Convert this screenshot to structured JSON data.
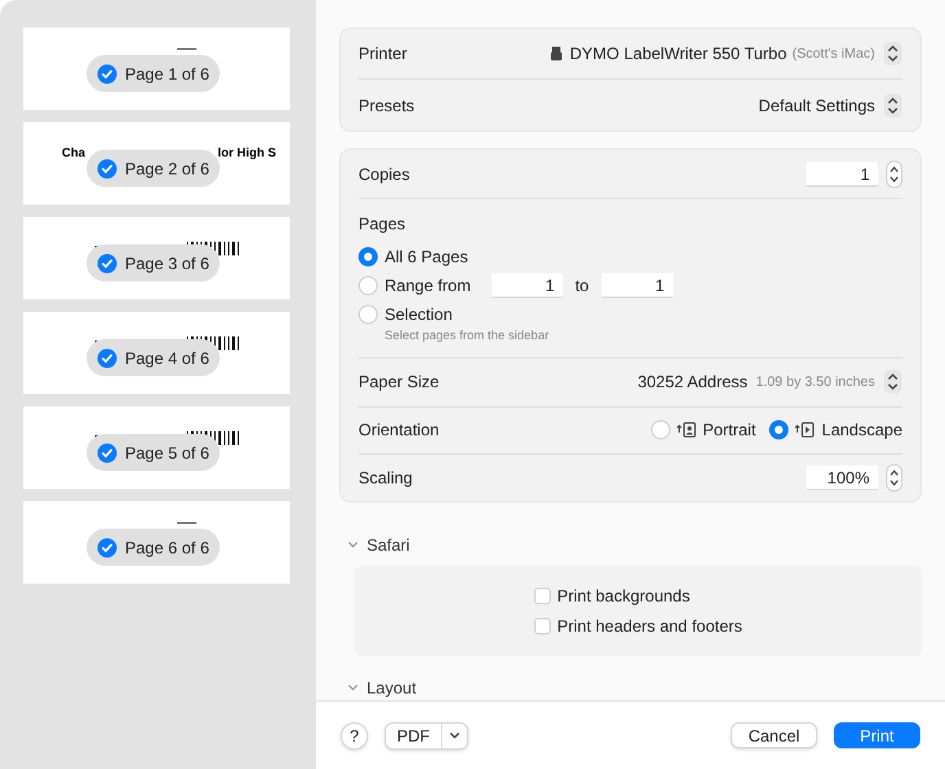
{
  "sidebar": {
    "pages": [
      {
        "label": "Page 1 of 6",
        "selected": true,
        "kind": "mark"
      },
      {
        "label": "Page 2 of 6",
        "selected": true,
        "kind": "text",
        "preview_text": [
          "Cha",
          "lor High S"
        ]
      },
      {
        "label": "Page 3 of 6",
        "selected": true,
        "kind": "barcode"
      },
      {
        "label": "Page 4 of 6",
        "selected": true,
        "kind": "barcode"
      },
      {
        "label": "Page 5 of 6",
        "selected": true,
        "kind": "barcode"
      },
      {
        "label": "Page 6 of 6",
        "selected": true,
        "kind": "mark"
      }
    ]
  },
  "printer": {
    "label": "Printer",
    "value": "DYMO LabelWriter 550 Turbo",
    "host": "(Scott's iMac)"
  },
  "presets": {
    "label": "Presets",
    "value": "Default Settings"
  },
  "copies": {
    "label": "Copies",
    "value": "1"
  },
  "pages": {
    "label": "Pages",
    "options": [
      {
        "label": "All 6 Pages",
        "selected": true,
        "kind": "plain"
      },
      {
        "label": "Range from",
        "selected": false,
        "kind": "range",
        "from": "1",
        "to_label": "to",
        "to": "1"
      },
      {
        "label": "Selection",
        "selected": false,
        "kind": "hint",
        "hint": "Select pages from the sidebar"
      }
    ]
  },
  "paper_size": {
    "label": "Paper Size",
    "value": "30252 Address",
    "detail": "1.09 by 3.50 inches"
  },
  "orientation": {
    "label": "Orientation",
    "options": [
      {
        "label": "Portrait",
        "selected": false,
        "kind": "portrait"
      },
      {
        "label": "Landscape",
        "selected": true,
        "kind": "landscape"
      }
    ]
  },
  "scaling": {
    "label": "Scaling",
    "value": "100%"
  },
  "sections": [
    {
      "title": "Safari",
      "expanded": true,
      "checkboxes": [
        {
          "label": "Print backgrounds",
          "checked": false
        },
        {
          "label": "Print headers and footers",
          "checked": false
        }
      ]
    },
    {
      "title": "Layout",
      "expanded": true
    }
  ],
  "footer": {
    "help": "?",
    "pdf": "PDF",
    "buttons": [
      {
        "label": "Cancel",
        "kind": "secondary"
      },
      {
        "label": "Print",
        "kind": "primary"
      }
    ]
  }
}
